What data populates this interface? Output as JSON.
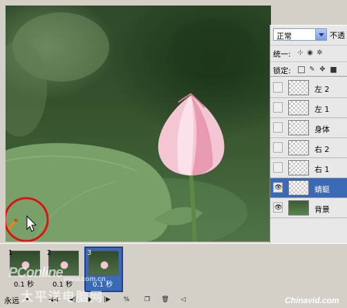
{
  "canvas": {
    "subject": "lotus-bud",
    "cursor": "arrow-cursor",
    "annotation": "red-circle-highlight"
  },
  "layers_panel": {
    "blend_mode": "正常",
    "opacity_label": "不透",
    "unify_label": "统一:",
    "lock_label": "锁定:",
    "layers": [
      {
        "name": "左 2",
        "visible": false,
        "selected": false,
        "thumb": "transparent"
      },
      {
        "name": "左 1",
        "visible": false,
        "selected": false,
        "thumb": "transparent"
      },
      {
        "name": "身体",
        "visible": false,
        "selected": false,
        "thumb": "transparent"
      },
      {
        "name": "右 2",
        "visible": false,
        "selected": false,
        "thumb": "transparent"
      },
      {
        "name": "右 1",
        "visible": false,
        "selected": false,
        "thumb": "transparent"
      },
      {
        "name": "蜻蜓",
        "visible": true,
        "selected": true,
        "thumb": "transparent"
      },
      {
        "name": "背景",
        "visible": true,
        "selected": false,
        "thumb": "photo"
      }
    ]
  },
  "timeline": {
    "frames": [
      {
        "num": "1",
        "delay": "0.1 秒"
      },
      {
        "num": "2",
        "delay": "0.1 秒"
      },
      {
        "num": "3",
        "delay": "0.1 秒",
        "selected": true
      }
    ],
    "loop": "永远"
  },
  "watermarks": {
    "pconline": "PConline",
    "url": "www.com.cn",
    "cn": "太平洋电脑网",
    "chinavid": "Chinavid.com"
  },
  "colors": {
    "selection": "#3a6ab5",
    "annotation": "#e01010",
    "bud_pink": "#f2b8c9"
  }
}
